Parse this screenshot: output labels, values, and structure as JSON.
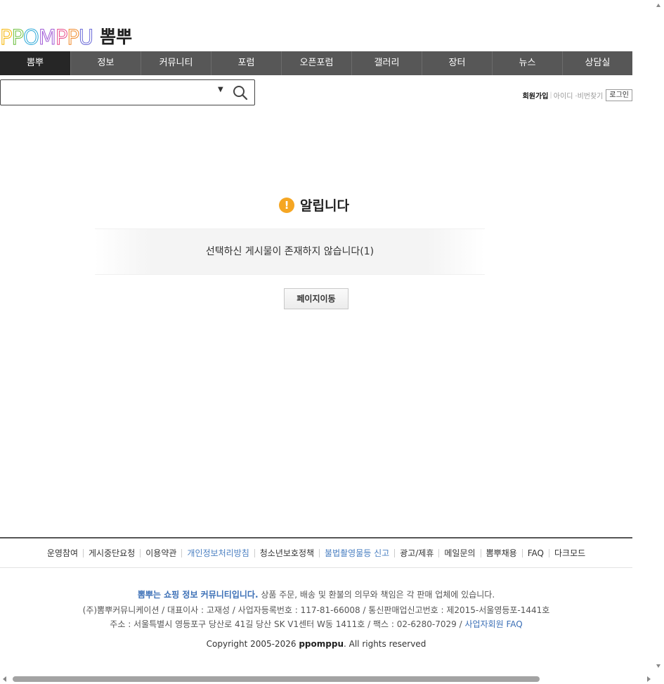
{
  "header": {
    "logo_letters": [
      "P",
      "P",
      "O",
      "M",
      "P",
      "P",
      "U"
    ],
    "logo_colors": [
      "#f5b400",
      "#6bbf3c",
      "#2aa8d8",
      "#a05bd6",
      "#e84a8a",
      "#f08a2a",
      "#6b6bd8"
    ],
    "logo_korean": "뽐뿌",
    "nav": [
      "뽐뿌",
      "정보",
      "커뮤니티",
      "포럼",
      "오픈포럼",
      "갤러리",
      "장터",
      "뉴스",
      "상담실"
    ],
    "search": {
      "placeholder": "",
      "dropdown_glyph": "▼"
    },
    "member": {
      "join": "회원가입",
      "find_id": "아이디",
      "find_pw": "·비번찾기",
      "login": "로그인"
    }
  },
  "notice": {
    "title": "알립니다",
    "icon": "!",
    "message": "선택하신 게시물이 존재하지 않습니다(1)",
    "button": "페이지이동"
  },
  "footer": {
    "links": [
      {
        "label": "운영참여",
        "color": "default"
      },
      {
        "label": "게시중단요청",
        "color": "default"
      },
      {
        "label": "이용약관",
        "color": "default"
      },
      {
        "label": "개인정보처리방침",
        "color": "blue"
      },
      {
        "label": "청소년보호정책",
        "color": "default"
      },
      {
        "label": "불법촬영물등 신고",
        "color": "blue"
      },
      {
        "label": "광고/제휴",
        "color": "default"
      },
      {
        "label": "메일문의",
        "color": "default"
      },
      {
        "label": "뽐뿌채용",
        "color": "default"
      },
      {
        "label": "FAQ",
        "color": "default"
      },
      {
        "label": "다크모드",
        "color": "default"
      }
    ],
    "slogan_strong": "뽐뿌는 쇼핑 정보 커뮤니티입니다.",
    "slogan_rest": " 상품 주문, 배송 및 환불의 의무와 책임은 각 판매 업체에 있습니다.",
    "company": "(주)뽐뿌커뮤니케이션 / 대표이사 : 고재성 / 사업자등록번호 : 117-81-66008 / 통신판매업신고번호 : 제2015-서울영등포-1441호",
    "address": "주소 : 서울특별시 영등포구 당산로 41길 당산 SK V1센터 W동 1411호 / 팩스 : 02-6280-7029 / ",
    "biz_faq": "사업자회원 FAQ",
    "copyright_pre": "Copyright 2005-2026 ",
    "copyright_brand": "ppomppu",
    "copyright_post": ". All rights reserved"
  },
  "colors": {
    "nav_bg": "#575757",
    "nav_active": "#262626",
    "alert": "#f5a623",
    "link_blue": "#3b6fb6"
  }
}
